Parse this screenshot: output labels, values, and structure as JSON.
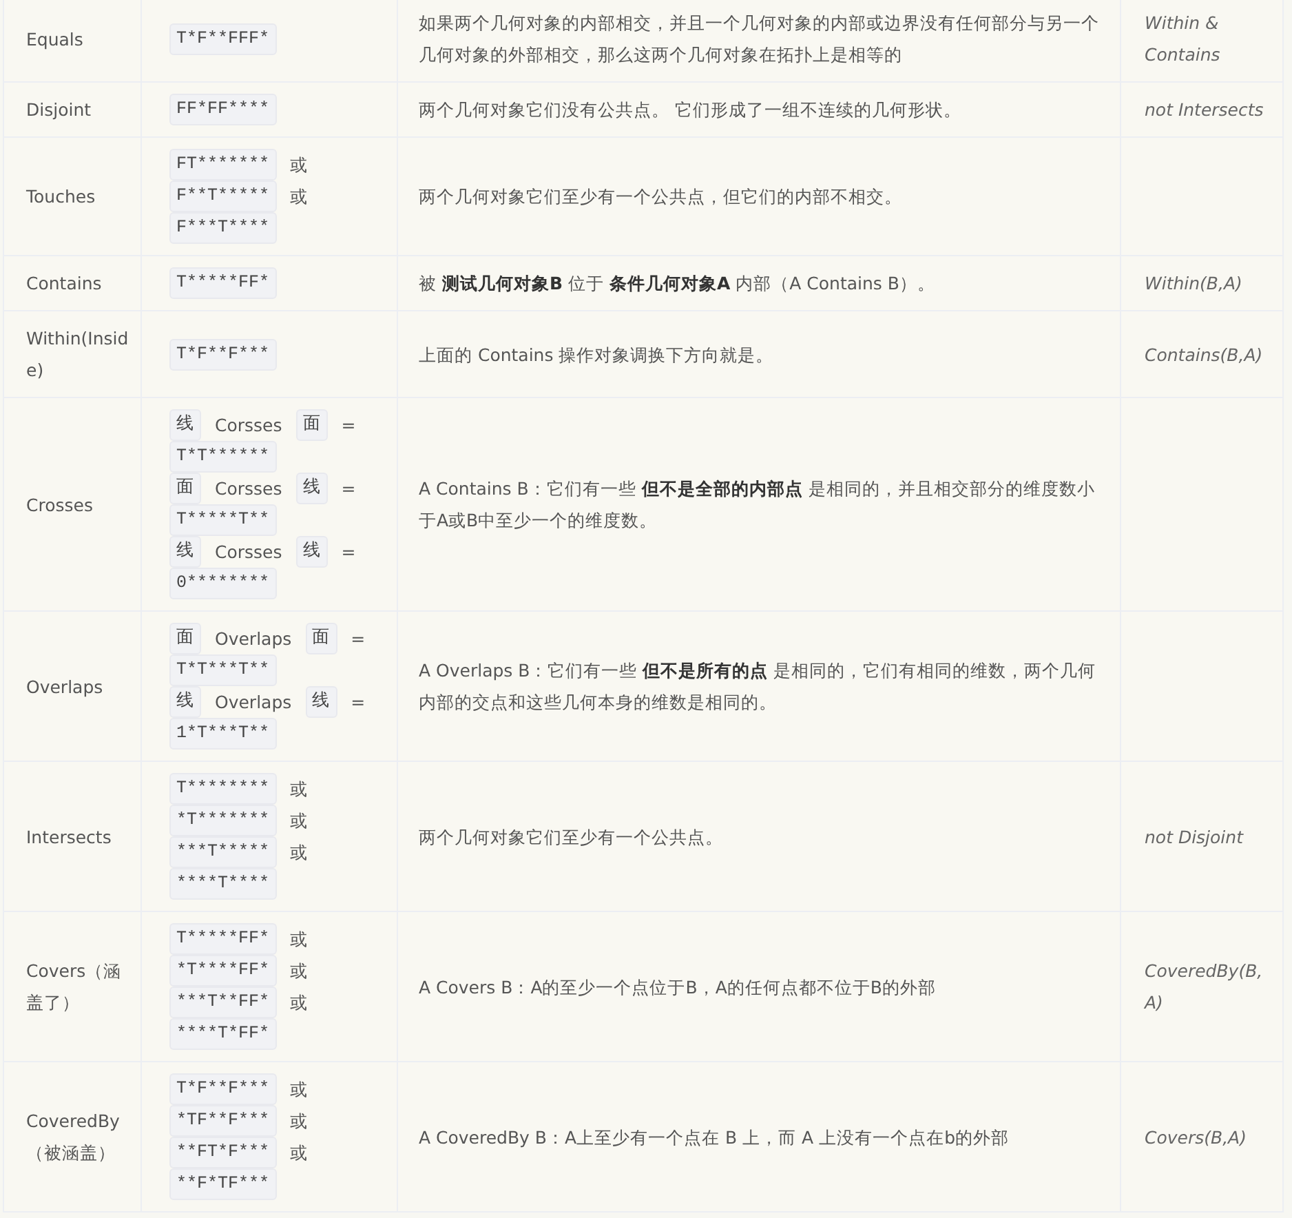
{
  "table": {
    "rows": [
      {
        "name": "Equals",
        "matrix": [
          [
            {
              "kind": "code",
              "text": "T*F**FFF*"
            }
          ]
        ],
        "description": "如果两个几何对象的内部相交，并且一个几何对象的内部或边界没有任何部分与另一个几何对象的外部相交，那么这两个几何对象在拓扑上是相等的",
        "note": "Within  & Contains"
      },
      {
        "name": "Disjoint",
        "matrix": [
          [
            {
              "kind": "code",
              "text": "FF*FF****"
            }
          ]
        ],
        "description": "两个几何对象它们没有公共点。 它们形成了一组不连续的几何形状。",
        "note": "not Intersects"
      },
      {
        "name": "Touches",
        "matrix": [
          [
            {
              "kind": "code",
              "text": "FT*******"
            },
            {
              "kind": "text",
              "text": "或"
            }
          ],
          [
            {
              "kind": "code",
              "text": "F**T*****"
            },
            {
              "kind": "text",
              "text": "或"
            }
          ],
          [
            {
              "kind": "code",
              "text": "F***T****"
            }
          ]
        ],
        "description": "两个几何对象它们至少有一个公共点，但它们的内部不相交。"
      },
      {
        "name": "Contains",
        "matrix": [
          [
            {
              "kind": "code",
              "text": "T*****FF*"
            }
          ]
        ],
        "description": "被 **测试几何对象B** 位于 **条件几何对象A** 内部（A Contains B）。",
        "note": "Within(B,A)"
      },
      {
        "name": "Within(Inside)",
        "matrix": [
          [
            {
              "kind": "code",
              "text": "T*F**F***"
            }
          ]
        ],
        "description": "上面的 Contains 操作对象调换下方向就是。",
        "note": "Contains(B,A)"
      },
      {
        "name": "Crosses",
        "matrix": [
          [
            {
              "kind": "code",
              "text": "线"
            },
            {
              "kind": "text",
              "text": "Corsses"
            },
            {
              "kind": "code",
              "text": "面"
            },
            {
              "kind": "text",
              "text": "="
            }
          ],
          [
            {
              "kind": "code",
              "text": "T*T******"
            }
          ],
          [
            {
              "kind": "code",
              "text": "面"
            },
            {
              "kind": "text",
              "text": "Corsses"
            },
            {
              "kind": "code",
              "text": "线"
            },
            {
              "kind": "text",
              "text": "="
            }
          ],
          [
            {
              "kind": "code",
              "text": "T*****T**"
            }
          ],
          [
            {
              "kind": "code",
              "text": "线"
            },
            {
              "kind": "text",
              "text": "Corsses"
            },
            {
              "kind": "code",
              "text": "线"
            },
            {
              "kind": "text",
              "text": "="
            }
          ],
          [
            {
              "kind": "code",
              "text": "0********"
            }
          ]
        ],
        "description": "A Contains B：它们有一些 **但不是全部的内部点** 是相同的，并且相交部分的维度数小于A或B中至少一个的维度数。"
      },
      {
        "name": "Overlaps",
        "matrix": [
          [
            {
              "kind": "code",
              "text": "面"
            },
            {
              "kind": "text",
              "text": "Overlaps"
            },
            {
              "kind": "code",
              "text": "面"
            },
            {
              "kind": "text",
              "text": "="
            }
          ],
          [
            {
              "kind": "code",
              "text": "T*T***T**"
            }
          ],
          [
            {
              "kind": "code",
              "text": "线"
            },
            {
              "kind": "text",
              "text": "Overlaps"
            },
            {
              "kind": "code",
              "text": "线"
            },
            {
              "kind": "text",
              "text": "="
            }
          ],
          [
            {
              "kind": "code",
              "text": "1*T***T**"
            }
          ]
        ],
        "description": "A Overlaps B：它们有一些 **但不是所有的点** 是相同的，它们有相同的维数，两个几何内部的交点和这些几何本身的维数是相同的。"
      },
      {
        "name": "Intersects",
        "matrix": [
          [
            {
              "kind": "code",
              "text": "T********"
            },
            {
              "kind": "text",
              "text": "或"
            }
          ],
          [
            {
              "kind": "code",
              "text": "*T*******"
            },
            {
              "kind": "text",
              "text": "或"
            }
          ],
          [
            {
              "kind": "code",
              "text": "***T*****"
            },
            {
              "kind": "text",
              "text": "或"
            }
          ],
          [
            {
              "kind": "code",
              "text": "****T****"
            }
          ]
        ],
        "description": "两个几何对象它们至少有一个公共点。",
        "note": "not Disjoint"
      },
      {
        "name": "Covers（涵盖了）",
        "matrix": [
          [
            {
              "kind": "code",
              "text": "T*****FF*"
            },
            {
              "kind": "text",
              "text": "或"
            }
          ],
          [
            {
              "kind": "code",
              "text": "*T****FF*"
            },
            {
              "kind": "text",
              "text": "或"
            }
          ],
          [
            {
              "kind": "code",
              "text": "***T**FF*"
            },
            {
              "kind": "text",
              "text": "或"
            }
          ],
          [
            {
              "kind": "code",
              "text": "****T*FF*"
            }
          ]
        ],
        "description": "A Covers B：A的至少一个点位于B，A的任何点都不位于B的外部",
        "note": "CoveredBy(B,A)"
      },
      {
        "name": "CoveredBy（被涵盖）",
        "matrix": [
          [
            {
              "kind": "code",
              "text": "T*F**F***"
            },
            {
              "kind": "text",
              "text": "或"
            }
          ],
          [
            {
              "kind": "code",
              "text": "*TF**F***"
            },
            {
              "kind": "text",
              "text": "或"
            }
          ],
          [
            {
              "kind": "code",
              "text": "**FT*F***"
            },
            {
              "kind": "text",
              "text": "或"
            }
          ],
          [
            {
              "kind": "code",
              "text": "**F*TF***"
            }
          ]
        ],
        "description": "A CoveredBy B：A上至少有一个点在 B 上，而 A 上没有一个点在b的外部",
        "note": "Covers(B,A)"
      }
    ]
  }
}
